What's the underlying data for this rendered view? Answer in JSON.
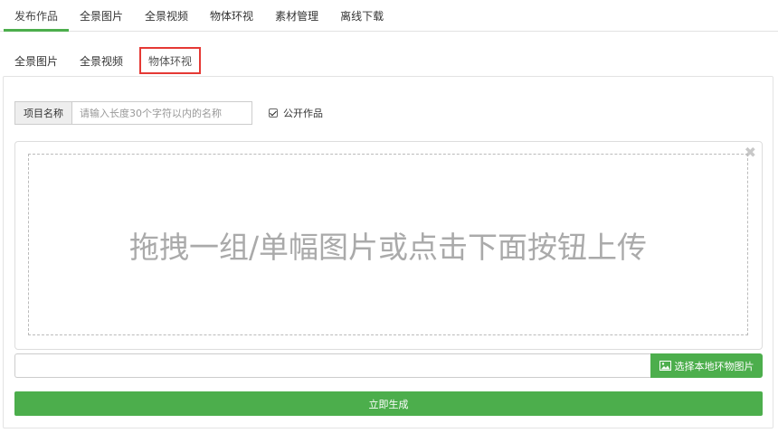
{
  "topnav": {
    "items": [
      {
        "label": "发布作品",
        "active": true
      },
      {
        "label": "全景图片"
      },
      {
        "label": "全景视频"
      },
      {
        "label": "物体环视"
      },
      {
        "label": "素材管理"
      },
      {
        "label": "离线下载"
      }
    ]
  },
  "subtabs": {
    "items": [
      {
        "label": "全景图片"
      },
      {
        "label": "全景视频"
      },
      {
        "label": "物体环视",
        "highlighted": true
      }
    ]
  },
  "form": {
    "name_label": "项目名称",
    "name_placeholder": "请输入长度30个字符以内的名称",
    "name_value": "",
    "public_label": "公开作品",
    "public_checked": true,
    "drop_text": "拖拽一组/单幅图片或点击下面按钮上传",
    "close_icon": "close-icon",
    "file_path_value": "",
    "choose_label": "选择本地环物图片",
    "choose_icon": "picture-icon",
    "generate_label": "立即生成"
  },
  "colors": {
    "accent": "#4cae4c",
    "highlight_border": "#e53935"
  }
}
